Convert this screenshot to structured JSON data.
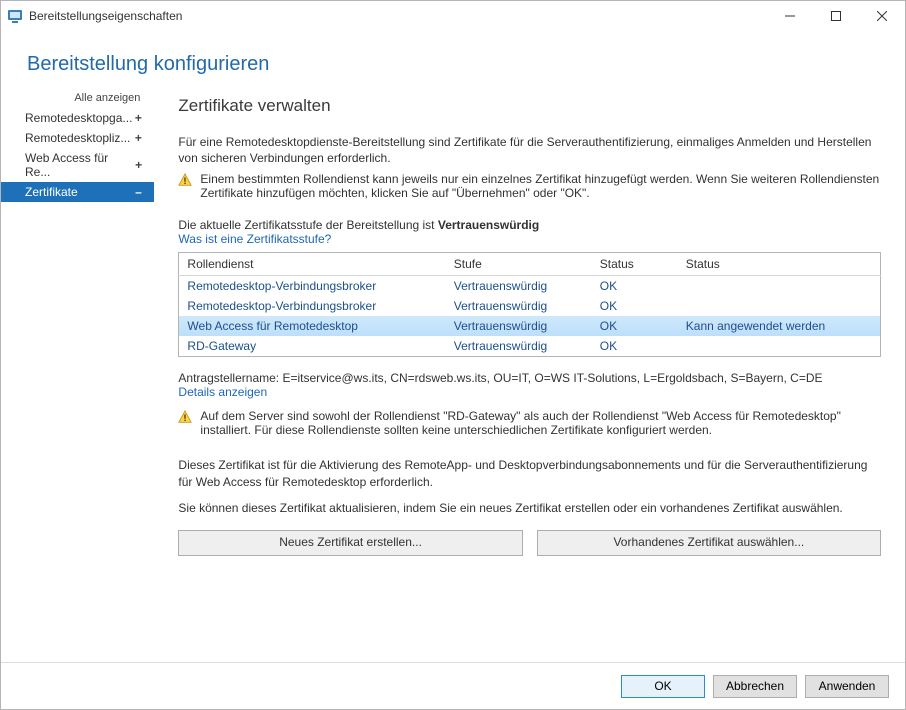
{
  "window": {
    "title": "Bereitstellungseigenschaften"
  },
  "page_title": "Bereitstellung konfigurieren",
  "sidebar": {
    "show_all": "Alle anzeigen",
    "items": [
      {
        "label": "Remotedesktopga...",
        "expand": "+",
        "selected": false
      },
      {
        "label": "Remotedesktopliz...",
        "expand": "+",
        "selected": false
      },
      {
        "label": "Web Access für Re...",
        "expand": "+",
        "selected": false
      },
      {
        "label": "Zertifikate",
        "expand": "–",
        "selected": true
      }
    ]
  },
  "main": {
    "heading": "Zertifikate verwalten",
    "intro": "Für eine Remotedesktopdienste-Bereitstellung sind Zertifikate für die Serverauthentifizierung, einmaliges Anmelden und Herstellen von sicheren Verbindungen erforderlich.",
    "warn1": "Einem bestimmten Rollendienst kann jeweils nur ein einzelnes Zertifikat hinzugefügt werden. Wenn Sie weiteren Rollendiensten Zertifikate hinzufügen möchten, klicken Sie auf \"Übernehmen\" oder \"OK\".",
    "level_line_pre": "Die aktuelle Zertifikatsstufe der Bereitstellung ist ",
    "level_line_bold": "Vertrauenswürdig",
    "level_link": "Was ist eine Zertifikatsstufe?",
    "table": {
      "headers": [
        "Rollendienst",
        "Stufe",
        "Status",
        "Status"
      ],
      "rows": [
        {
          "role": "Remotedesktop-Verbindungsbroker",
          "level": "Vertrauenswürdig",
          "status": "OK",
          "status2": "",
          "selected": false
        },
        {
          "role": "Remotedesktop-Verbindungsbroker",
          "level": "Vertrauenswürdig",
          "status": "OK",
          "status2": "",
          "selected": false
        },
        {
          "role": "Web Access für Remotedesktop",
          "level": "Vertrauenswürdig",
          "status": "OK",
          "status2": "Kann angewendet werden",
          "selected": true
        },
        {
          "role": "RD-Gateway",
          "level": "Vertrauenswürdig",
          "status": "OK",
          "status2": "",
          "selected": false
        }
      ]
    },
    "subject": "Antragstellername: E=itservice@ws.its, CN=rdsweb.ws.its, OU=IT, O=WS IT-Solutions, L=Ergoldsbach, S=Bayern, C=DE",
    "details_link": "Details anzeigen",
    "warn2": "Auf dem Server sind sowohl der Rollendienst \"RD-Gateway\" als auch der Rollendienst \"Web Access für Remotedesktop\" installiert. Für diese Rollendienste sollten keine unterschiedlichen Zertifikate konfiguriert werden.",
    "para1": "Dieses Zertifikat ist für die Aktivierung des RemoteApp- und Desktopverbindungsabonnements und für die Serverauthentifizierung für Web Access für Remotedesktop erforderlich.",
    "para2": "Sie können dieses Zertifikat aktualisieren, indem Sie ein neues Zertifikat erstellen oder ein vorhandenes Zertifikat auswählen.",
    "new_cert_btn": "Neues Zertifikat erstellen...",
    "select_cert_btn": "Vorhandenes Zertifikat auswählen..."
  },
  "buttons": {
    "ok": "OK",
    "cancel": "Abbrechen",
    "apply": "Anwenden"
  }
}
